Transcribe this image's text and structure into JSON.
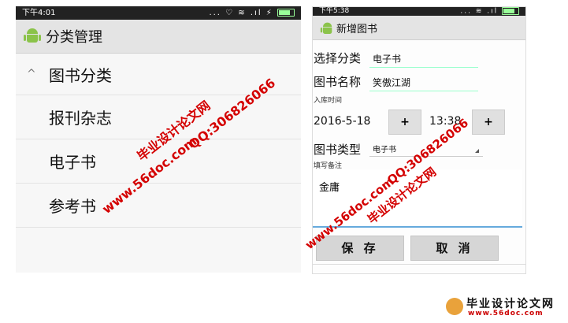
{
  "left": {
    "status_time": "下午4:01",
    "status_icons": "... ♡ ≋ .ıl ⚡",
    "app_title": "分类管理",
    "group_label": "图书分类",
    "items": [
      "报刊杂志",
      "电子书",
      "参考书"
    ]
  },
  "right": {
    "status_time": "下午5:38",
    "status_icons": "... ≋ .ıl",
    "app_title": "新增图书",
    "category_label": "选择分类",
    "category_value": "电子书",
    "name_label": "图书名称",
    "name_value": "笑傲江湖",
    "stock_time_label": "入库时间",
    "date_value": "2016-5-18",
    "time_value": "13:38",
    "plus_label": "+",
    "type_label": "图书类型",
    "type_value": "电子书",
    "remark_label": "填写备注",
    "remark_value": "金庸",
    "save_label": "保 存",
    "cancel_label": "取 消"
  },
  "watermark": {
    "site_cn": "毕业设计论文网",
    "site_url": "www.56doc.com",
    "qq": "QQ:306826066"
  },
  "logo": {
    "cn": "毕业设计论文网",
    "url": "www.56doc.com"
  }
}
